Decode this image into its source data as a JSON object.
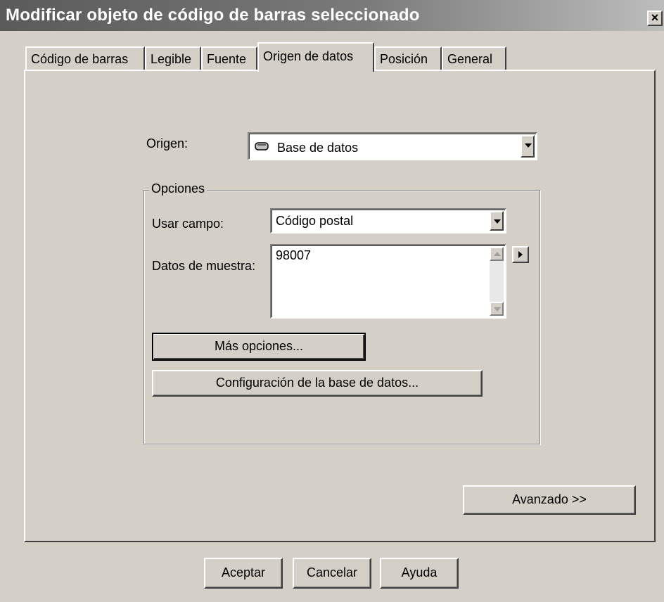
{
  "window": {
    "title": "Modificar objeto de código de barras seleccionado",
    "close_glyph": "×"
  },
  "tabs": [
    {
      "label": "Código de barras",
      "active": false
    },
    {
      "label": "Legible",
      "active": false
    },
    {
      "label": "Fuente",
      "active": false
    },
    {
      "label": "Origen de datos",
      "active": true
    },
    {
      "label": "Posición",
      "active": false
    },
    {
      "label": "General",
      "active": false
    }
  ],
  "origin": {
    "label": "Origen:",
    "value": "Base de datos",
    "icon": "database-icon"
  },
  "options": {
    "legend": "Opciones",
    "field_label": "Usar campo:",
    "field_value": "Código postal",
    "sample_label": "Datos de muestra:",
    "sample_value": "98007",
    "more_options_label": "Más opciones...",
    "db_config_label": "Configuración de la base de datos..."
  },
  "advanced_label": "Avanzado >>",
  "footer": {
    "ok_label": "Aceptar",
    "cancel_label": "Cancelar",
    "help_label": "Ayuda"
  }
}
